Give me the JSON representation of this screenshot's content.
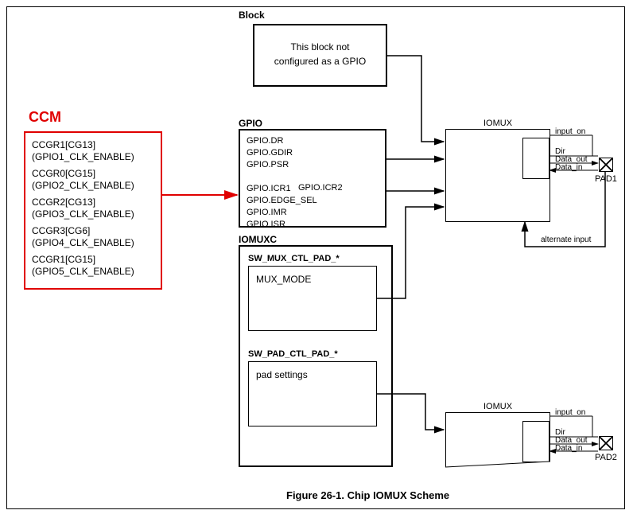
{
  "outer": {},
  "block": {
    "title": "Block",
    "text_line1": "This block not",
    "text_line2": "configured as a GPIO"
  },
  "ccm": {
    "title": "CCM",
    "entries": [
      {
        "reg": "CCGR1[CG13]",
        "desc": "(GPIO1_CLK_ENABLE)"
      },
      {
        "reg": "CCGR0[CG15]",
        "desc": "(GPIO2_CLK_ENABLE)"
      },
      {
        "reg": "CCGR2[CG13]",
        "desc": "(GPIO3_CLK_ENABLE)"
      },
      {
        "reg": "CCGR3[CG6]",
        "desc": "(GPIO4_CLK_ENABLE)"
      },
      {
        "reg": "CCGR1[CG15]",
        "desc": "(GPIO5_CLK_ENABLE)"
      }
    ]
  },
  "gpio": {
    "title": "GPIO",
    "regs": [
      "GPIO.DR",
      "GPIO.GDIR",
      "GPIO.PSR",
      "",
      "GPIO.ICR1",
      "GPIO.EDGE_SEL",
      "GPIO.IMR",
      "GPIO.ISR"
    ],
    "icr2": "GPIO.ICR2"
  },
  "iomuxc": {
    "title": "IOMUXC",
    "swmux": {
      "title": "SW_MUX_CTL_PAD_*",
      "text": "MUX_MODE"
    },
    "swpad": {
      "title": "SW_PAD_CTL_PAD_*",
      "text": "pad settings"
    }
  },
  "iomux1": {
    "title": "IOMUX",
    "signals": {
      "input_on": "input_on",
      "dir": "Dir",
      "data_out": "Data_out",
      "data_in": "Data_in"
    },
    "alt_input": "alternate input"
  },
  "iomux2": {
    "title": "IOMUX",
    "signals": {
      "input_on": "input_on",
      "dir": "Dir",
      "data_out": "Data_out",
      "data_in": "Data_in"
    }
  },
  "pad1": {
    "label": "PAD1"
  },
  "pad2": {
    "label": "PAD2"
  },
  "caption": "Figure 26-1. Chip IOMUX Scheme"
}
